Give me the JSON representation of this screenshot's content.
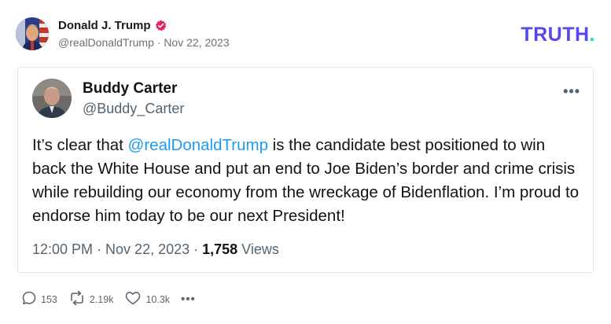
{
  "post": {
    "author_name": "Donald J. Trump",
    "author_handle": "@realDonaldTrump",
    "separator": " · ",
    "date": "Nov 22, 2023",
    "brand_logo": "TRUTH",
    "brand_logo_dot": ".",
    "colors": {
      "brand": "#5448ee",
      "brand_dot": "#16d9c8",
      "verified": "#e0245e"
    }
  },
  "embed": {
    "author_name": "Buddy Carter",
    "author_handle": "@Buddy_Carter",
    "more_icon": "ellipsis-icon",
    "text_before": "It’s clear that ",
    "mention": "@realDonaldTrump",
    "text_after": " is the candidate best positioned to win back the White House and put an end to Joe Biden’s border and crime crisis while rebuilding our economy from the wreckage of Bidenflation. I’m proud to endorse him today to be our next President!",
    "time": "12:00 PM",
    "separator": " · ",
    "date": "Nov 22, 2023",
    "separator2": " · ",
    "views_count": "1,758",
    "views_label": " Views",
    "colors": {
      "mention": "#1d9bf0"
    }
  },
  "actions": {
    "replies": "153",
    "retruths": "2.19k",
    "likes": "10.3k",
    "more": "•••"
  }
}
